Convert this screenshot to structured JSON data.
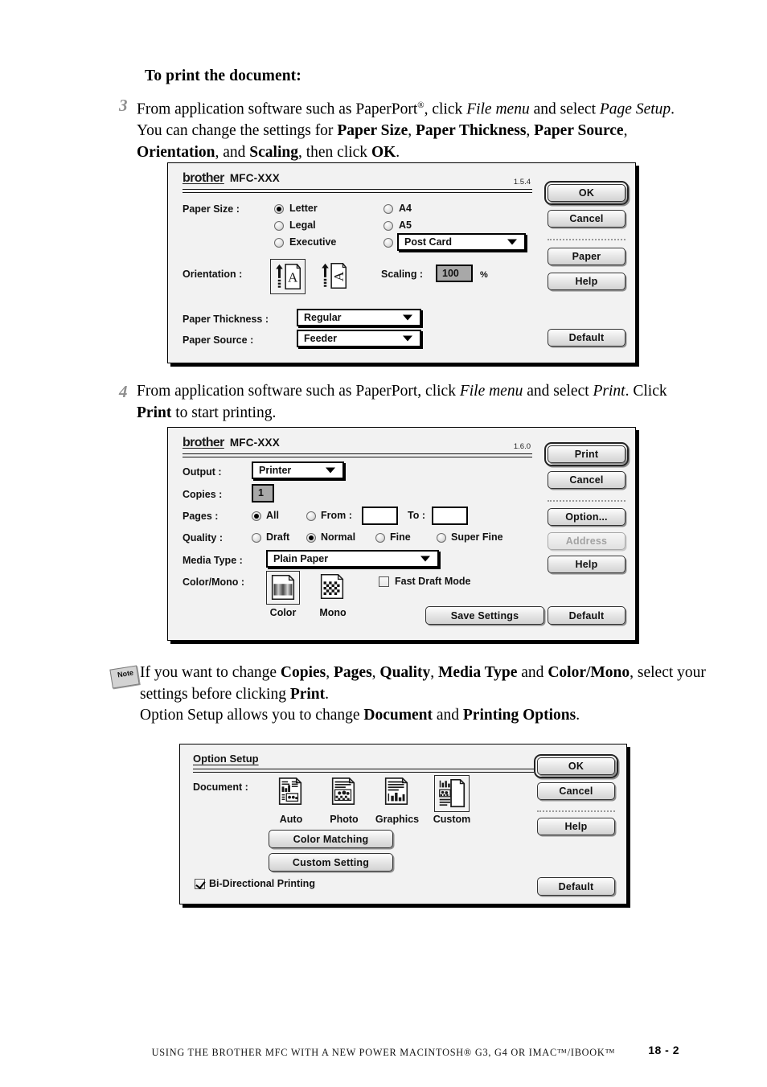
{
  "document": {
    "heading": "To print the document:",
    "step3": {
      "number": "3",
      "text_parts": [
        {
          "t": "From application software such as PaperPort",
          "s": "n"
        },
        {
          "t": "®",
          "s": "sup"
        },
        {
          "t": ", click ",
          "s": "n"
        },
        {
          "t": "File menu",
          "s": "i"
        },
        {
          "t": " and select ",
          "s": "n"
        },
        {
          "t": "Page Setup",
          "s": "i"
        },
        {
          "t": ". You can change the settings for ",
          "s": "n"
        },
        {
          "t": "Paper Size",
          "s": "b"
        },
        {
          "t": ", ",
          "s": "n"
        },
        {
          "t": "Paper Thickness",
          "s": "b"
        },
        {
          "t": ", ",
          "s": "n"
        },
        {
          "t": "Paper Source",
          "s": "b"
        },
        {
          "t": ", ",
          "s": "n"
        },
        {
          "t": "Orientation",
          "s": "b"
        },
        {
          "t": ", and ",
          "s": "n"
        },
        {
          "t": "Scaling",
          "s": "b"
        },
        {
          "t": ", then click ",
          "s": "n"
        },
        {
          "t": "OK",
          "s": "b"
        },
        {
          "t": ".",
          "s": "n"
        }
      ]
    },
    "step4": {
      "number": "4",
      "text_parts": [
        {
          "t": "From application software such as PaperPort, click ",
          "s": "n"
        },
        {
          "t": "File menu",
          "s": "i"
        },
        {
          "t": " and select ",
          "s": "n"
        },
        {
          "t": "Print",
          "s": "i"
        },
        {
          "t": ". Click ",
          "s": "n"
        },
        {
          "t": "Print",
          "s": "b"
        },
        {
          "t": " to start printing.",
          "s": "n"
        }
      ]
    },
    "note": {
      "icon_label": "Note",
      "text_parts": [
        {
          "t": "If you want to change ",
          "s": "n"
        },
        {
          "t": "Copies",
          "s": "b"
        },
        {
          "t": ", ",
          "s": "n"
        },
        {
          "t": "Pages",
          "s": "b"
        },
        {
          "t": ", ",
          "s": "n"
        },
        {
          "t": "Quality",
          "s": "b"
        },
        {
          "t": ", ",
          "s": "n"
        },
        {
          "t": "Media Type",
          "s": "b"
        },
        {
          "t": " and ",
          "s": "n"
        },
        {
          "t": "Color/Mono",
          "s": "b"
        },
        {
          "t": ", select your settings before clicking ",
          "s": "n"
        },
        {
          "t": "Print",
          "s": "b"
        },
        {
          "t": ".",
          "s": "n"
        },
        {
          "t": "\n",
          "s": "br"
        },
        {
          "t": "Option Setup allows you to change ",
          "s": "n"
        },
        {
          "t": "Document",
          "s": "b"
        },
        {
          "t": " and ",
          "s": "n"
        },
        {
          "t": "Printing Options",
          "s": "b"
        },
        {
          "t": ".",
          "s": "n"
        }
      ]
    }
  },
  "page_setup_dialog": {
    "brand": "brother",
    "model": "MFC-XXX",
    "version": "1.5.4",
    "paper_size_label": "Paper Size :",
    "paper_size_options": [
      {
        "label": "Letter",
        "selected": true
      },
      {
        "label": "Legal",
        "selected": false
      },
      {
        "label": "Executive",
        "selected": false
      },
      {
        "label": "A4",
        "selected": false
      },
      {
        "label": "A5",
        "selected": false
      }
    ],
    "postcard_radio_selected": false,
    "postcard_value": "Post Card",
    "orientation_label": "Orientation :",
    "orientation_portrait_selected": true,
    "scaling_label": "Scaling :",
    "scaling_value": "100",
    "scaling_unit": "%",
    "paper_thickness_label": "Paper Thickness :",
    "paper_thickness_value": "Regular",
    "paper_source_label": "Paper Source :",
    "paper_source_value": "Feeder",
    "buttons": {
      "ok": "OK",
      "cancel": "Cancel",
      "paper": "Paper",
      "help": "Help",
      "default": "Default"
    }
  },
  "print_dialog": {
    "brand": "brother",
    "model": "MFC-XXX",
    "version": "1.6.0",
    "output_label": "Output :",
    "output_value": "Printer",
    "copies_label": "Copies :",
    "copies_value": "1",
    "pages_label": "Pages :",
    "pages_all_label": "All",
    "pages_all_selected": true,
    "pages_from_label": "From :",
    "pages_from_selected": false,
    "pages_from_value": "",
    "pages_to_label": "To :",
    "pages_to_value": "",
    "quality_label": "Quality :",
    "quality_options": [
      {
        "label": "Draft",
        "selected": false
      },
      {
        "label": "Normal",
        "selected": true
      },
      {
        "label": "Fine",
        "selected": false
      },
      {
        "label": "Super Fine",
        "selected": false
      }
    ],
    "media_type_label": "Media Type :",
    "media_type_value": "Plain Paper",
    "color_mono_label": "Color/Mono :",
    "color_caption": "Color",
    "mono_caption": "Mono",
    "color_selected": true,
    "fast_draft_label": "Fast Draft Mode",
    "fast_draft_checked": false,
    "buttons": {
      "print": "Print",
      "cancel": "Cancel",
      "option": "Option...",
      "address": "Address",
      "address_disabled": true,
      "help": "Help",
      "save_settings": "Save Settings",
      "default": "Default"
    }
  },
  "option_setup_dialog": {
    "title": "Option Setup",
    "document_label": "Document :",
    "document_icons": [
      {
        "label": "Auto",
        "selected": false
      },
      {
        "label": "Photo",
        "selected": false
      },
      {
        "label": "Graphics",
        "selected": false
      },
      {
        "label": "Custom",
        "selected": true
      }
    ],
    "color_matching_button": "Color Matching",
    "custom_setting_button": "Custom Setting",
    "bidirectional_label": "Bi-Directional Printing",
    "bidirectional_checked": true,
    "buttons": {
      "ok": "OK",
      "cancel": "Cancel",
      "help": "Help",
      "default": "Default"
    }
  },
  "footer": {
    "text": "USING THE BROTHER MFC WITH A NEW POWER MACINTOSH® G3, G4 OR IMAC™/IBOOK™",
    "page": "18 - 2"
  }
}
